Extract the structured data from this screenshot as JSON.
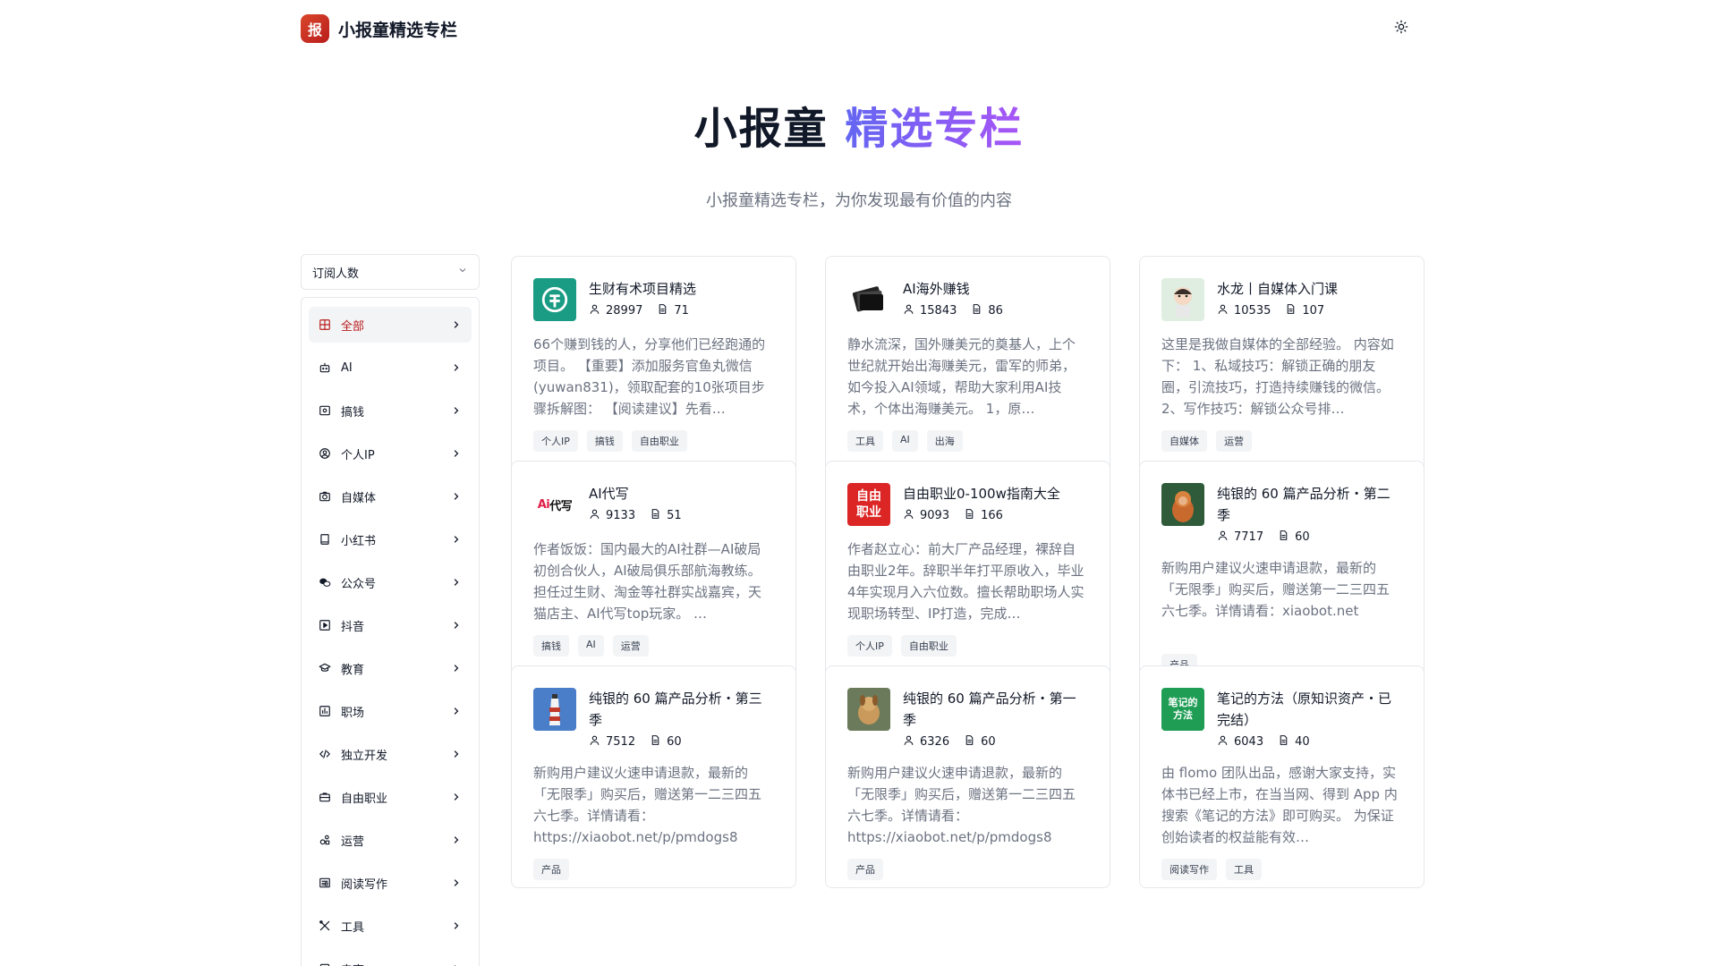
{
  "header": {
    "logo_char": "报",
    "brand": "小报童精选专栏"
  },
  "hero": {
    "title_main": "小报童",
    "title_accent": "精选专栏",
    "subtitle": "小报童精选专栏，为你发现最有价值的内容"
  },
  "sort": {
    "label": "订阅人数"
  },
  "sidebar": {
    "items": [
      {
        "label": "全部",
        "icon": "grid-icon"
      },
      {
        "label": "AI",
        "icon": "robot-icon"
      },
      {
        "label": "搞钱",
        "icon": "money-icon"
      },
      {
        "label": "个人IP",
        "icon": "user-circle-icon"
      },
      {
        "label": "自媒体",
        "icon": "camera-icon"
      },
      {
        "label": "小红书",
        "icon": "book-icon"
      },
      {
        "label": "公众号",
        "icon": "wechat-icon"
      },
      {
        "label": "抖音",
        "icon": "play-icon"
      },
      {
        "label": "教育",
        "icon": "graduation-cap-icon"
      },
      {
        "label": "职场",
        "icon": "chart-icon"
      },
      {
        "label": "独立开发",
        "icon": "code-icon"
      },
      {
        "label": "自由职业",
        "icon": "briefcase-icon"
      },
      {
        "label": "运营",
        "icon": "shapes-icon"
      },
      {
        "label": "阅读写作",
        "icon": "newspaper-icon"
      },
      {
        "label": "工具",
        "icon": "tools-icon"
      },
      {
        "label": "电商",
        "icon": "shop-icon"
      }
    ]
  },
  "cards": [
    {
      "title": "生财有术项目精选",
      "subscribers": "28997",
      "posts": "71",
      "desc": "66个赚到钱的人，分享他们已经跑通的项目。 【重要】添加服务官鱼丸微信(yuwan831)，领取配套的10张项目步骤拆解图： 【阅读建议】先看…",
      "tags": [
        "个人IP",
        "搞钱",
        "自由职业"
      ],
      "thumb": "shengcai"
    },
    {
      "title": "AI海外赚钱",
      "subscribers": "15843",
      "posts": "86",
      "desc": "静水流深，国外赚美元的奠基人，上个世纪就开始出海赚美元，雷军的师弟，如今投入AI领域，帮助大家利用AI技术，个体出海赚美元。 1，原…",
      "tags": [
        "工具",
        "AI",
        "出海"
      ],
      "thumb": "ai-overseas"
    },
    {
      "title": "水龙丨自媒体入门课",
      "subscribers": "10535",
      "posts": "107",
      "desc": "这里是我做自媒体的全部经验。 内容如下： 1、私域技巧：解锁正确的朋友圈，引流技巧，打造持续赚钱的微信。 2、写作技巧：解锁公众号排…",
      "tags": [
        "自媒体",
        "运营"
      ],
      "thumb": "shuilong"
    },
    {
      "title": "AI代写",
      "subscribers": "9133",
      "posts": "51",
      "desc": "作者饭饭：国内最大的AI社群—AI破局初创合伙人，AI破局俱乐部航海教练。担任过生财、淘金等社群实战嘉宾，天猫店主、AI代写top玩家。 …",
      "tags": [
        "搞钱",
        "AI",
        "运营"
      ],
      "thumb": "ai-write",
      "thumb_text": "Ai代写"
    },
    {
      "title": "自由职业0-100w指南大全",
      "subscribers": "9093",
      "posts": "166",
      "desc": "作者赵立心：前大厂产品经理，裸辞自由职业2年。辞职半年打平原收入，毕业4年实现月入六位数。擅长帮助职场人实现职场转型、IP打造，完成…",
      "tags": [
        "个人IP",
        "自由职业"
      ],
      "thumb": "freelance",
      "thumb_text": "自由职业"
    },
    {
      "title": "纯银的 60 篇产品分析・第二季",
      "subscribers": "7717",
      "posts": "60",
      "desc": "新购用户建议火速申请退款，最新的「无限季」购买后，赠送第一二三四五六七季。详情请看：xiaobot.net",
      "tags": [
        "产品"
      ],
      "thumb": "monkey"
    },
    {
      "title": "纯银的 60 篇产品分析・第三季",
      "subscribers": "7512",
      "posts": "60",
      "desc": "新购用户建议火速申请退款，最新的「无限季」购买后，赠送第一二三四五六七季。详情请看：https://xiaobot.net/p/pmdogs8",
      "tags": [
        "产品"
      ],
      "thumb": "lighthouse"
    },
    {
      "title": "纯银的 60 篇产品分析・第一季",
      "subscribers": "6326",
      "posts": "60",
      "desc": "新购用户建议火速申请退款，最新的「无限季」购买后，赠送第一二三四五六七季。详情请看：https://xiaobot.net/p/pmdogs8",
      "tags": [
        "产品"
      ],
      "thumb": "dog"
    },
    {
      "title": "笔记的方法（原知识资产・已完结）",
      "subscribers": "6043",
      "posts": "40",
      "desc": "由 flomo 团队出品，感谢大家支持，实体书已经上市，在当当网、得到 App 内搜索《笔记的方法》即可购买。 为保证创始读者的权益能有效…",
      "tags": [
        "阅读写作",
        "工具"
      ],
      "thumb": "notes",
      "thumb_text": "笔记的方法"
    }
  ]
}
